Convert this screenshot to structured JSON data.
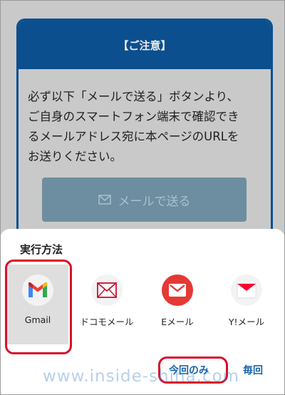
{
  "notice": {
    "title": "【ご注意】",
    "lines": [
      "必ず以下「メールで送る」ボタンより、",
      "ご自身のスマートフォン端末で確認でき",
      "るメールアドレス宛に本ページのURLを",
      "お送りください。"
    ],
    "button_label": "メールで送る"
  },
  "sheet": {
    "title": "実行方法",
    "apps": [
      {
        "label": "Gmail",
        "icon": "gmail-icon",
        "selected": true
      },
      {
        "label": "ドコモメール",
        "icon": "docomo-mail-icon",
        "selected": false
      },
      {
        "label": "Eメール",
        "icon": "email-icon",
        "selected": false
      },
      {
        "label": "Y!メール",
        "icon": "ymail-icon",
        "selected": false
      }
    ],
    "actions": {
      "once": "今回のみ",
      "always": "毎回"
    }
  },
  "watermark": "www.inside-shiha.com",
  "colors": {
    "accent": "#0b4f8f",
    "highlight": "#d8102a",
    "action": "#1a66a8"
  }
}
